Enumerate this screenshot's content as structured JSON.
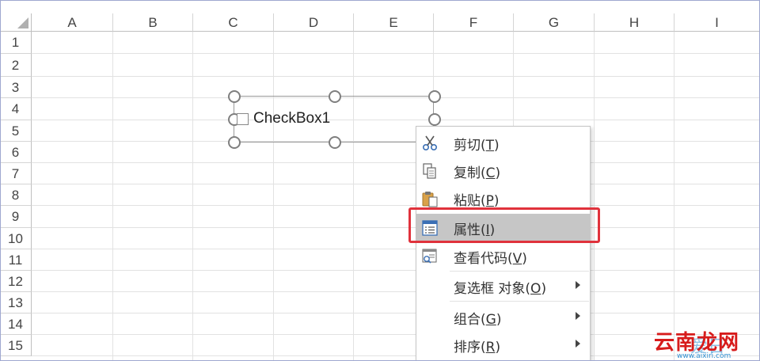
{
  "spreadsheet": {
    "columns": [
      "A",
      "B",
      "C",
      "D",
      "E",
      "F",
      "G",
      "H",
      "I"
    ],
    "rows": [
      "1",
      "2",
      "3",
      "4",
      "5",
      "6",
      "7",
      "8",
      "9",
      "10",
      "11",
      "12",
      "13",
      "14",
      "15"
    ]
  },
  "checkbox": {
    "label": "CheckBox1"
  },
  "context_menu": {
    "items": [
      {
        "label": "剪切",
        "shortcut": "T",
        "icon": "scissors-icon"
      },
      {
        "label": "复制",
        "shortcut": "C",
        "icon": "copy-icon"
      },
      {
        "label": "粘贴",
        "shortcut": "P",
        "icon": "clipboard-paste-icon"
      },
      {
        "label": "属性",
        "shortcut": "I",
        "icon": "properties-icon",
        "selected": true
      },
      {
        "label": "查看代码",
        "shortcut": "V",
        "icon": "view-code-icon"
      },
      {
        "label": "复选框 对象",
        "shortcut": "O",
        "submenu": true
      },
      {
        "label": "组合",
        "shortcut": "G",
        "submenu": true
      },
      {
        "label": "排序",
        "shortcut": "R",
        "submenu": true
      }
    ]
  },
  "watermark": {
    "text": "云南龙网",
    "ghost": "爱日",
    "url": "www.aixiri.com"
  }
}
